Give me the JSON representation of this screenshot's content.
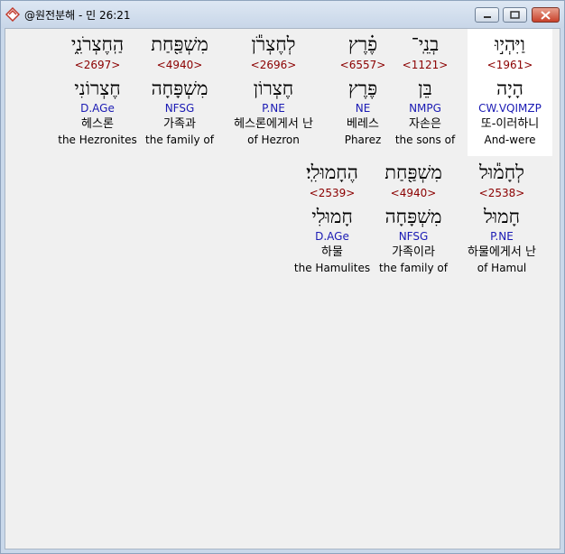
{
  "window": {
    "title": "@원전분해 - 민 26:21"
  },
  "words": [
    {
      "id": "w1",
      "heb": "וַיִּהְי֣וּ",
      "strong": "<1961>",
      "lex": "הָיָה",
      "morph": "CW.VQIMZP",
      "kor": "또-이러하니",
      "eng": "And-were",
      "selected": true
    },
    {
      "id": "w2",
      "heb": "בְנֵֽי־",
      "strong": "<1121>",
      "lex": "בֵּן",
      "morph": "NMPG",
      "kor": "자손은",
      "eng": "the sons of",
      "selected": false
    },
    {
      "id": "w3",
      "heb": "פֶ֗רֶץ",
      "strong": "<6557>",
      "lex": "פֶּרֶץ",
      "morph": "NE",
      "kor": "베레스",
      "eng": "Pharez",
      "selected": false
    },
    {
      "id": "w4",
      "heb": "לְחֶצְרֹ֕ן",
      "strong": "<2696>",
      "lex": "חֶצְרוֹן",
      "morph": "P.NE",
      "kor": "헤스론에게서 난",
      "eng": "of Hezron",
      "selected": false
    },
    {
      "id": "w5",
      "heb": "מִשְׁפַּ֖חַת",
      "strong": "<4940>",
      "lex": "מִשְׁפָּחָה",
      "morph": "NFSG",
      "kor": "가족과",
      "eng": "the family of",
      "selected": false
    },
    {
      "id": "w6",
      "heb": "הַֽחֶצְרֹנִ֑י",
      "strong": "<2697>",
      "lex": "חֶצְרוֹנִי",
      "morph": "D.AGe",
      "kor": "헤스론",
      "eng": "the Hezronites",
      "selected": false
    },
    {
      "id": "w7",
      "heb": "לְחָמ֕וּל",
      "strong": "<2538>",
      "lex": "חָמוּל",
      "morph": "P.NE",
      "kor": "하물에게서 난",
      "eng": "of Hamul",
      "selected": false
    },
    {
      "id": "w8",
      "heb": "מִשְׁפַּ֖חַת",
      "strong": "<4940>",
      "lex": "מִשְׁפָּחָה",
      "morph": "NFSG",
      "kor": "가족이라",
      "eng": "the family of",
      "selected": false
    },
    {
      "id": "w9",
      "heb": "הֶחָמוּלִֽי׃",
      "strong": "<2539>",
      "lex": "חָמוּלִי",
      "morph": "D.AGe",
      "kor": "하물",
      "eng": "the Hamulites",
      "selected": false
    }
  ]
}
